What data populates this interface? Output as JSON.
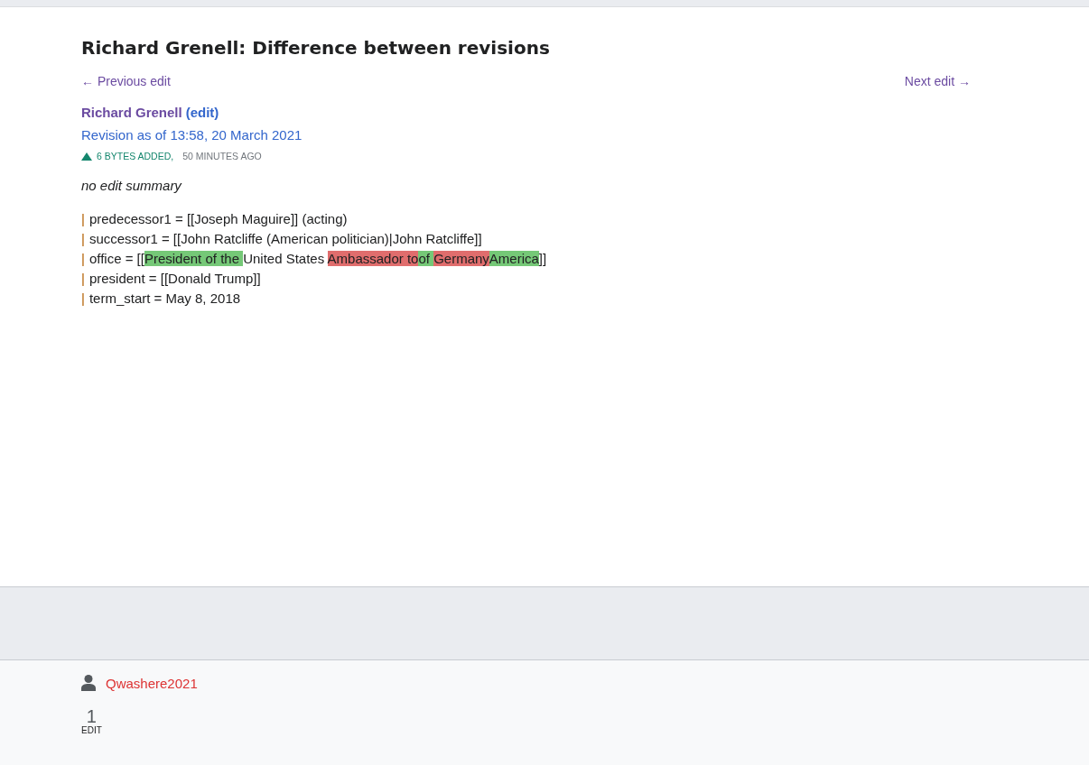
{
  "title": "Richard Grenell: Difference between revisions",
  "nav": {
    "previous": "← Previous edit",
    "next": "Next edit →"
  },
  "page": {
    "name": "Richard Grenell",
    "edit_link": "(edit)"
  },
  "revision": "Revision as of 13:58, 20 March 2021",
  "change": {
    "size": "6 BYTES ADDED,",
    "time": "50 MINUTES AGO"
  },
  "summary": "no edit summary",
  "diff_lines": [
    {
      "marker": "|",
      "segments": [
        {
          "kind": "context",
          "text": "predecessor1 = [[Joseph Maguire]] (acting)"
        }
      ]
    },
    {
      "marker": "|",
      "segments": [
        {
          "kind": "context",
          "text": "successor1 = [[John Ratcliffe (American politician)|John Ratcliffe]]"
        }
      ]
    },
    {
      "marker": "|",
      "segments": [
        {
          "kind": "context",
          "text": "office = [["
        },
        {
          "kind": "added",
          "text": "President of the "
        },
        {
          "kind": "context",
          "text": "United States "
        },
        {
          "kind": "removed",
          "text": "Ambassador to"
        },
        {
          "kind": "added",
          "text": "of "
        },
        {
          "kind": "removed",
          "text": "Germany"
        },
        {
          "kind": "added",
          "text": "America"
        },
        {
          "kind": "context",
          "text": "]]"
        }
      ]
    },
    {
      "marker": "|",
      "segments": [
        {
          "kind": "context",
          "text": "president = [[Donald Trump]]"
        }
      ]
    },
    {
      "marker": "|",
      "segments": [
        {
          "kind": "context",
          "text": "term_start = May 8, 2018"
        }
      ]
    }
  ],
  "footer": {
    "user": "Qwashere2021",
    "edit_count": "1",
    "edit_label": "EDIT"
  }
}
